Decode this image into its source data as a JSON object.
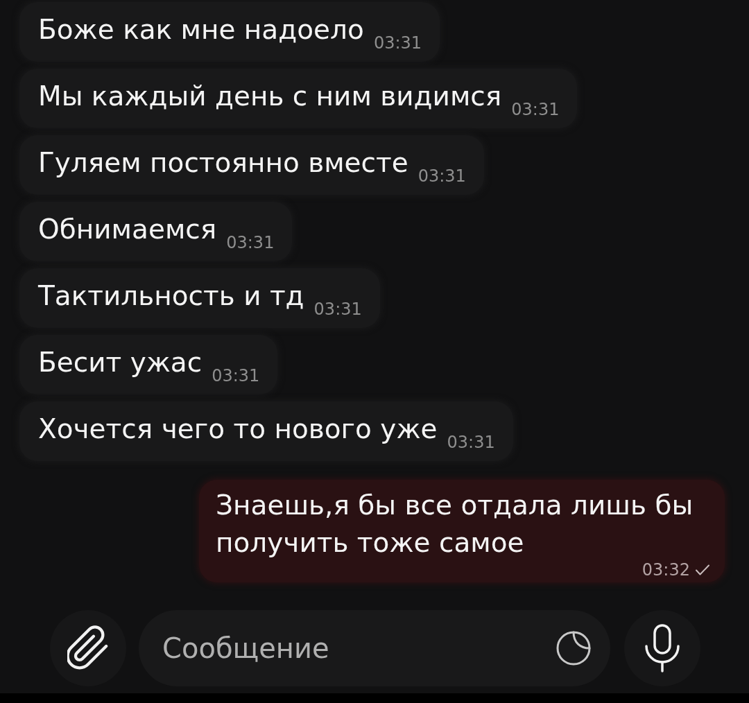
{
  "messages": [
    {
      "kind": "incoming",
      "text": "Боже как мне надоело",
      "time": "03:31"
    },
    {
      "kind": "incoming",
      "text": "Мы каждый день с ним видимся",
      "time": "03:31"
    },
    {
      "kind": "incoming",
      "text": "Гуляем постоянно вместе",
      "time": "03:31"
    },
    {
      "kind": "incoming",
      "text": "Обнимаемся",
      "time": "03:31"
    },
    {
      "kind": "incoming",
      "text": "Тактильность и тд",
      "time": "03:31"
    },
    {
      "kind": "incoming",
      "text": "Бесит ужас",
      "time": "03:31"
    },
    {
      "kind": "incoming",
      "text": "Хочется чего то нового уже",
      "time": "03:31"
    },
    {
      "kind": "outgoing",
      "text": "Знаешь,я бы все отдала лишь бы получить тоже самое",
      "time": "03:32",
      "read": false
    }
  ],
  "composer": {
    "placeholder": "Сообщение"
  }
}
